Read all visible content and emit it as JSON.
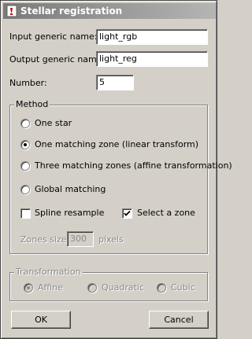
{
  "window": {
    "title": "Stellar registration",
    "icon": "app-icon"
  },
  "inputs": {
    "input_generic_name_label": "Input generic name:",
    "input_generic_name_value": "light_rgb",
    "output_generic_name_label": "Output generic name:",
    "output_generic_name_value": "light_reg",
    "number_label": "Number:",
    "number_value": "5"
  },
  "method": {
    "title": "Method",
    "options": [
      {
        "label": "One star",
        "selected": false
      },
      {
        "label": "One matching zone (linear transform)",
        "selected": true
      },
      {
        "label": "Three matching zones (affine transformation)",
        "selected": false
      },
      {
        "label": "Global matching",
        "selected": false
      }
    ],
    "spline_resample_label": "Spline resample",
    "spline_resample_checked": false,
    "select_zone_label": "Select a zone",
    "select_zone_checked": true,
    "zones_size_label": "Zones size:",
    "zones_size_value": "300",
    "zones_size_unit": "pixels"
  },
  "transformation": {
    "title": "Transformation",
    "options": [
      {
        "label": "Affine",
        "selected": true
      },
      {
        "label": "Quadratic",
        "selected": false
      },
      {
        "label": "Cubic",
        "selected": false
      }
    ]
  },
  "buttons": {
    "ok_label": "OK",
    "cancel_label": "Cancel"
  }
}
